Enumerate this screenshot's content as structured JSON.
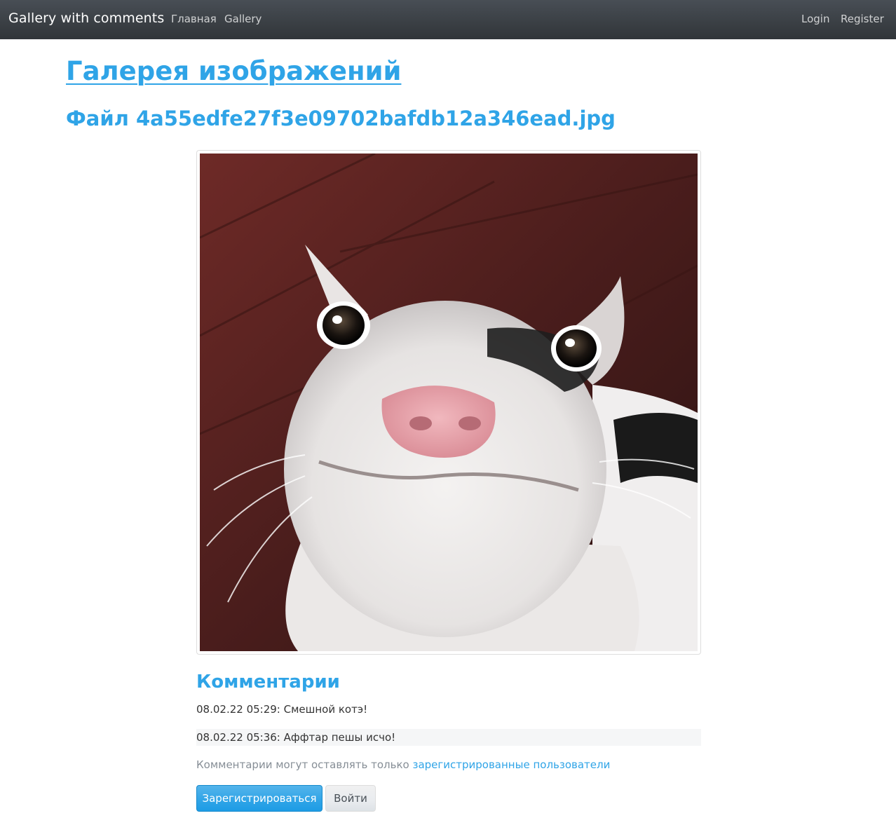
{
  "navbar": {
    "brand": "Gallery with comments",
    "links": [
      "Главная",
      "Gallery"
    ],
    "right_links": [
      "Login",
      "Register"
    ]
  },
  "main": {
    "title": "Галерея изображений",
    "file_title": "Файл 4a55edfe27f3e09702bafdb12a346ead.jpg",
    "image_icon": "cat-photo-icon"
  },
  "comments": {
    "title": "Комментарии",
    "items": [
      "08.02.22 05:29: Смешной котэ!",
      "08.02.22 05:36: Аффтар пешы исчо!"
    ],
    "notice_text": "Комментарии могут оставлять только ",
    "notice_link": "зарегистрированные пользователи"
  },
  "buttons": {
    "register": "Зарегистрироваться",
    "login": "Войти"
  },
  "colors": {
    "accent": "#2fa4e7",
    "navbar": "#3a3f44",
    "muted": "#868e96"
  }
}
